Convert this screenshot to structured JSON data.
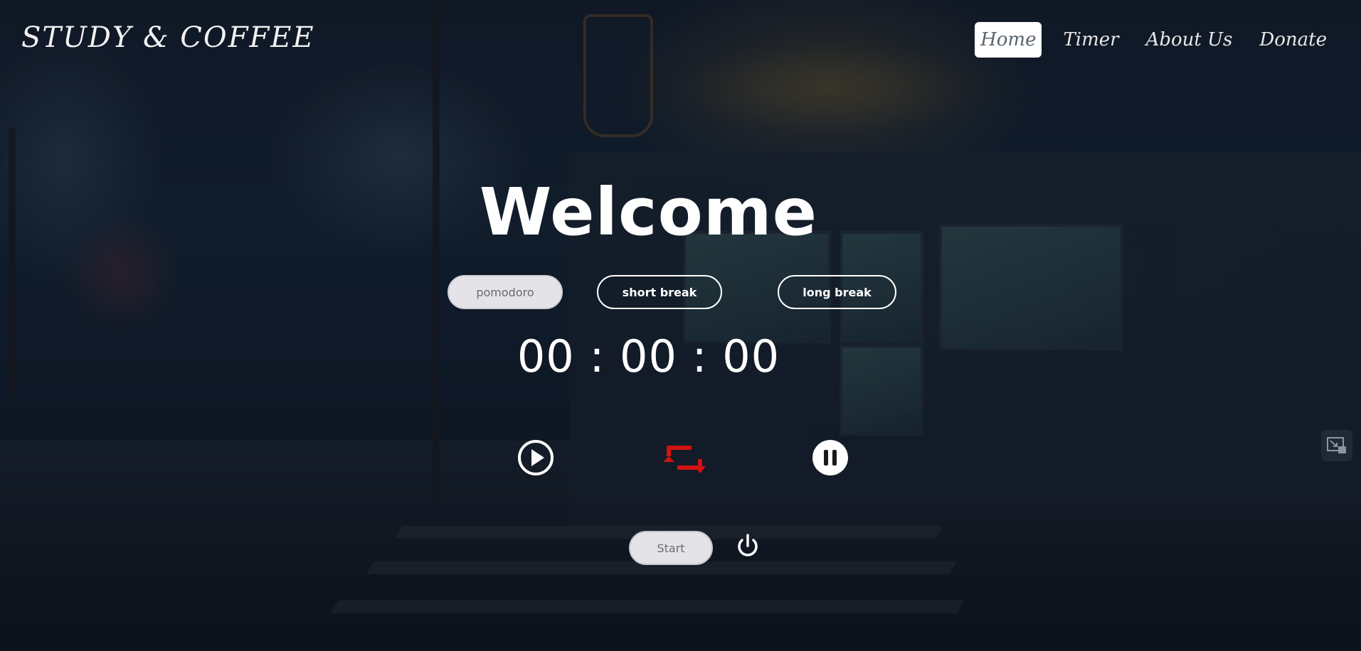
{
  "header": {
    "brand": "STUDY & COFFEE",
    "nav": [
      {
        "label": "Home",
        "active": true
      },
      {
        "label": "Timer",
        "active": false
      },
      {
        "label": "About Us",
        "active": false
      },
      {
        "label": "Donate",
        "active": false
      }
    ]
  },
  "main": {
    "title": "Welcome",
    "modes": [
      {
        "label": "pomodoro",
        "selected": true
      },
      {
        "label": "short break",
        "selected": false
      },
      {
        "label": "long break",
        "selected": false
      }
    ],
    "timer": "00 : 00 : 00",
    "controls": {
      "play_icon": "play-circle-icon",
      "repeat_icon": "repeat-icon",
      "pause_icon": "pause-circle-icon",
      "power_icon": "power-icon"
    },
    "start_label": "Start"
  },
  "corner": {
    "icon": "exit-fullscreen-icon"
  },
  "colors": {
    "accent_repeat": "#d11212",
    "text": "#ffffff",
    "active_nav_bg": "#ffffff",
    "button_fill": "#e4e4e8"
  }
}
